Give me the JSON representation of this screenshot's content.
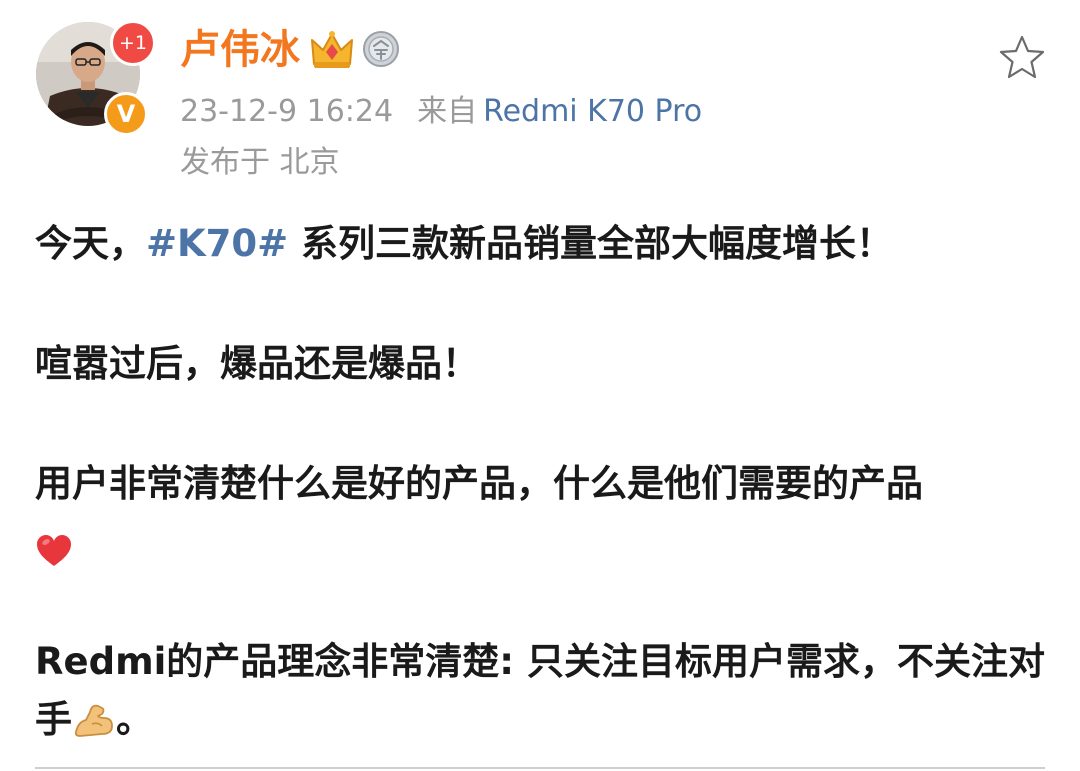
{
  "post": {
    "author": {
      "name": "卢伟冰",
      "follow_badge": "+1",
      "verified_badge": "V",
      "icons": [
        "crown-icon",
        "medal-icon"
      ]
    },
    "meta": {
      "date": "23-12-9 16:24",
      "from_label": "来自",
      "device": "Redmi K70 Pro",
      "location": "发布于 北京"
    },
    "body": {
      "p1_prefix": "今天，",
      "p1_hashtag": "#K70#",
      "p1_suffix": " 系列三款新品销量全部大幅度增长！",
      "p2": "喧嚣过后，爆品还是爆品！",
      "p3": "用户非常清楚什么是好的产品，什么是他们需要的产品",
      "p3_emoji": "heart-icon",
      "p4": "Redmi的产品理念非常清楚: 只关注目标用户需求，不关注对手",
      "p4_emoji": "flexed-biceps-icon",
      "p4_end": "。"
    },
    "colors": {
      "author_name": "#f2771f",
      "link": "#4d74a6",
      "meta_gray": "#9a9a9a",
      "text": "#1a1a1a",
      "badge_red": "#f04a45",
      "badge_orange": "#f59b1a"
    }
  }
}
